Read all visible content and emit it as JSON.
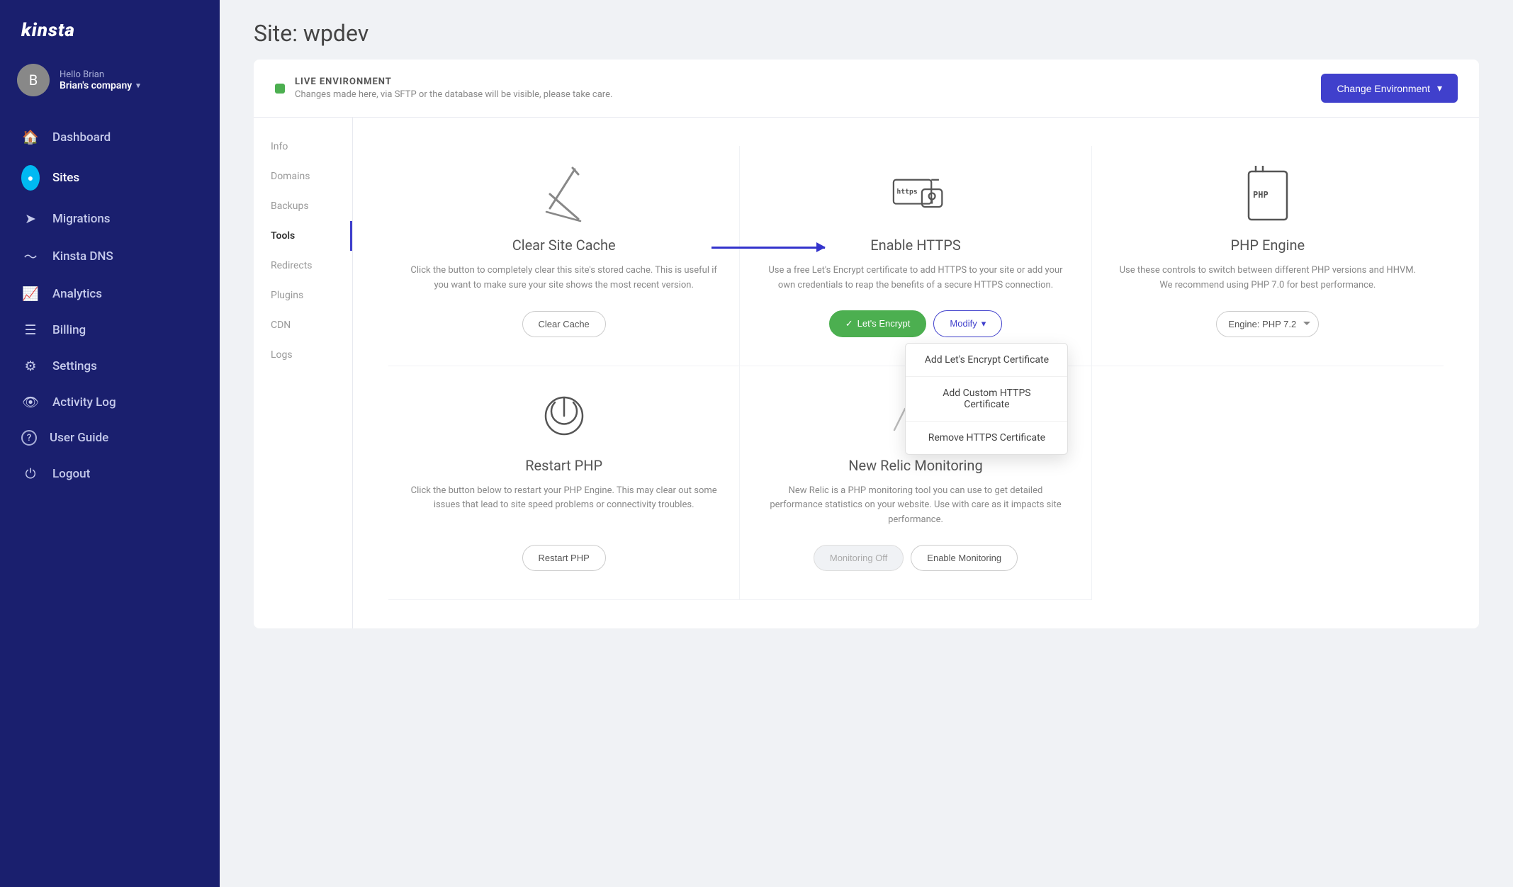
{
  "sidebar": {
    "logo": "kinsta",
    "user": {
      "greeting": "Hello Brian",
      "company": "Brian's company"
    },
    "nav": [
      {
        "id": "dashboard",
        "label": "Dashboard",
        "icon": "🏠",
        "active": false
      },
      {
        "id": "sites",
        "label": "Sites",
        "icon": "●",
        "active": true
      },
      {
        "id": "migrations",
        "label": "Migrations",
        "icon": "→",
        "active": false
      },
      {
        "id": "kinsta-dns",
        "label": "Kinsta DNS",
        "icon": "~",
        "active": false
      },
      {
        "id": "analytics",
        "label": "Analytics",
        "icon": "📈",
        "active": false
      },
      {
        "id": "billing",
        "label": "Billing",
        "icon": "☰",
        "active": false
      },
      {
        "id": "settings",
        "label": "Settings",
        "icon": "⚙",
        "active": false
      },
      {
        "id": "activity-log",
        "label": "Activity Log",
        "icon": "👁",
        "active": false
      },
      {
        "id": "user-guide",
        "label": "User Guide",
        "icon": "?",
        "active": false
      },
      {
        "id": "logout",
        "label": "Logout",
        "icon": "⏻",
        "active": false
      }
    ]
  },
  "header": {
    "title": "Site: wpdev"
  },
  "env_banner": {
    "title": "LIVE ENVIRONMENT",
    "description": "Changes made here, via SFTP or the database will be visible, please take care.",
    "change_btn": "Change Environment"
  },
  "sub_nav": {
    "items": [
      {
        "id": "info",
        "label": "Info",
        "active": false
      },
      {
        "id": "domains",
        "label": "Domains",
        "active": false
      },
      {
        "id": "backups",
        "label": "Backups",
        "active": false
      },
      {
        "id": "tools",
        "label": "Tools",
        "active": true
      },
      {
        "id": "redirects",
        "label": "Redirects",
        "active": false
      },
      {
        "id": "plugins",
        "label": "Plugins",
        "active": false
      },
      {
        "id": "cdn",
        "label": "CDN",
        "active": false
      },
      {
        "id": "logs",
        "label": "Logs",
        "active": false
      }
    ]
  },
  "tools": {
    "clear_cache": {
      "title": "Clear Site Cache",
      "description": "Click the button to completely clear this site's stored cache. This is useful if you want to make sure your site shows the most recent version.",
      "btn_label": "Clear Cache"
    },
    "enable_https": {
      "title": "Enable HTTPS",
      "description": "Use a free Let's Encrypt certificate to add HTTPS to your site or add your own credentials to reap the benefits of a secure HTTPS connection.",
      "btn_lets_encrypt": "Let's Encrypt",
      "btn_modify": "Modify",
      "dropdown": {
        "items": [
          "Add Let's Encrypt Certificate",
          "Add Custom HTTPS Certificate",
          "Remove HTTPS Certificate"
        ]
      }
    },
    "php_engine": {
      "title": "PHP Engine",
      "description": "Use these controls to switch between different PHP versions and HHVM. We recommend using PHP 7.0 for best performance.",
      "engine_label": "Engine: PHP 7.2"
    },
    "restart_php": {
      "title": "Restart PHP",
      "description": "Click the button below to restart your PHP Engine. This may clear out some issues that lead to site speed problems or connectivity troubles.",
      "btn_label": "Restart PHP"
    },
    "new_relic": {
      "title": "New Relic Monitoring",
      "description": "New Relic is a PHP monitoring tool you can use to get detailed performance statistics on your website. Use with care as it impacts site performance.",
      "btn_off": "Monitoring Off",
      "btn_enable": "Enable Monitoring"
    }
  }
}
